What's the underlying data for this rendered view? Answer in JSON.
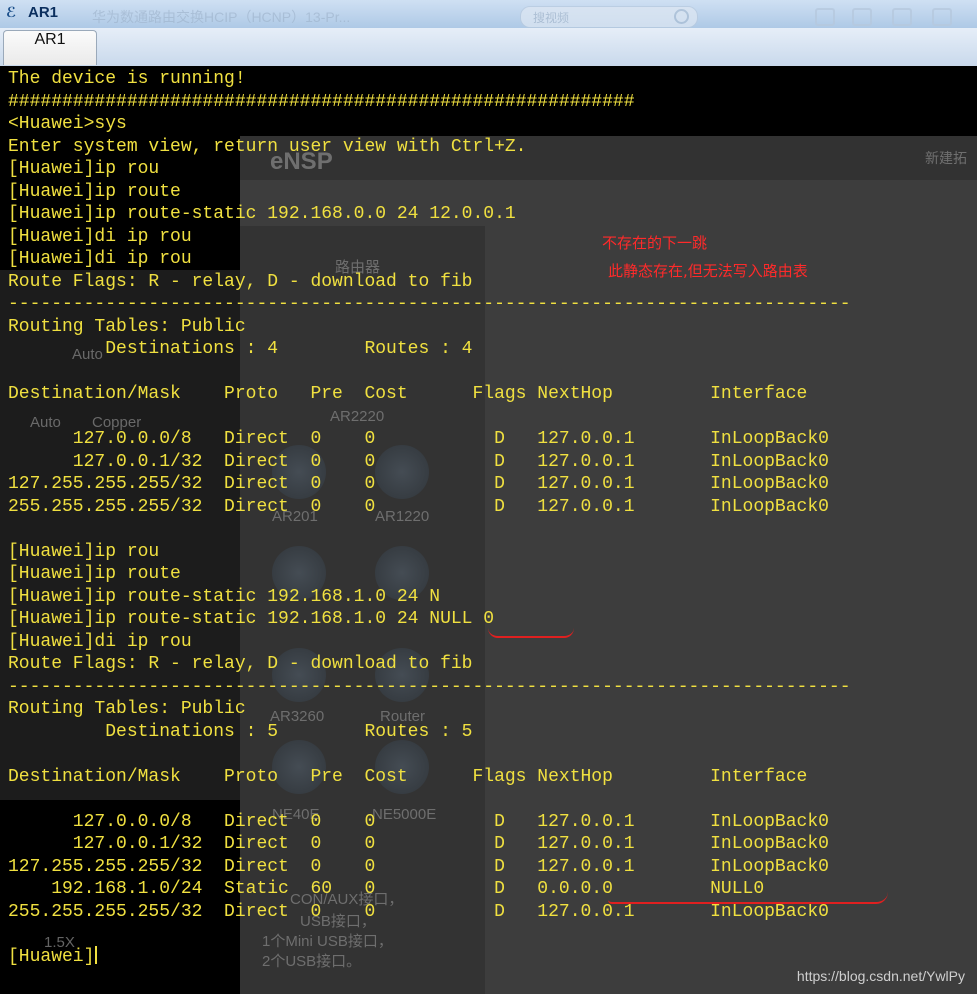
{
  "window": {
    "app_title": "AR1",
    "ghost_title": "华为数通路由交换HCIP（HCNP）13-Pr...",
    "search_placeholder": "搜视频"
  },
  "tabs": [
    {
      "label": "AR1"
    }
  ],
  "background_window": {
    "brand": "eNSP",
    "topology_label": "新建拓",
    "category_title": "路由器",
    "device_labels": [
      "AR2220",
      "AR201",
      "AR1220",
      "AR3260",
      "Router",
      "NE40E",
      "NE5000E"
    ],
    "left_labels": [
      "Auto",
      "Copper",
      "Auto"
    ],
    "description": [
      "CON/AUX接口，",
      "USB接口，",
      "1个Mini USB接口，",
      "2个USB接口。"
    ],
    "zoom": "1.5X"
  },
  "terminal": {
    "lines": [
      "The device is running!",
      "##########################################################",
      "<Huawei>sys",
      "Enter system view, return user view with Ctrl+Z.",
      "[Huawei]ip rou",
      "[Huawei]ip route",
      "[Huawei]ip route-static 192.168.0.0 24 12.0.0.1",
      "[Huawei]di ip rou",
      "[Huawei]di ip rou",
      "Route Flags: R - relay, D - download to fib",
      "------------------------------------------------------------------------------",
      "Routing Tables: Public",
      "         Destinations : 4        Routes : 4",
      "",
      "Destination/Mask    Proto   Pre  Cost      Flags NextHop         Interface",
      "",
      "      127.0.0.0/8   Direct  0    0           D   127.0.0.1       InLoopBack0",
      "      127.0.0.1/32  Direct  0    0           D   127.0.0.1       InLoopBack0",
      "127.255.255.255/32  Direct  0    0           D   127.0.0.1       InLoopBack0",
      "255.255.255.255/32  Direct  0    0           D   127.0.0.1       InLoopBack0",
      "",
      "[Huawei]ip rou",
      "[Huawei]ip route",
      "[Huawei]ip route-static 192.168.1.0 24 N",
      "[Huawei]ip route-static 192.168.1.0 24 NULL 0",
      "[Huawei]di ip rou",
      "Route Flags: R - relay, D - download to fib",
      "------------------------------------------------------------------------------",
      "Routing Tables: Public",
      "         Destinations : 5        Routes : 5",
      "",
      "Destination/Mask    Proto   Pre  Cost      Flags NextHop         Interface",
      "",
      "      127.0.0.0/8   Direct  0    0           D   127.0.0.1       InLoopBack0",
      "      127.0.0.1/32  Direct  0    0           D   127.0.0.1       InLoopBack0",
      "127.255.255.255/32  Direct  0    0           D   127.0.0.1       InLoopBack0",
      "    192.168.1.0/24  Static  60   0           D   0.0.0.0         NULL0",
      "255.255.255.255/32  Direct  0    0           D   127.0.0.1       InLoopBack0",
      "",
      "[Huawei]"
    ]
  },
  "annotations": {
    "note1": "不存在的下一跳",
    "note2": "此静态存在,但无法写入路由表"
  },
  "watermark": "https://blog.csdn.net/YwlPy",
  "colors": {
    "terminal_text": "#f0e040",
    "annotation": "#ff2a2a"
  }
}
